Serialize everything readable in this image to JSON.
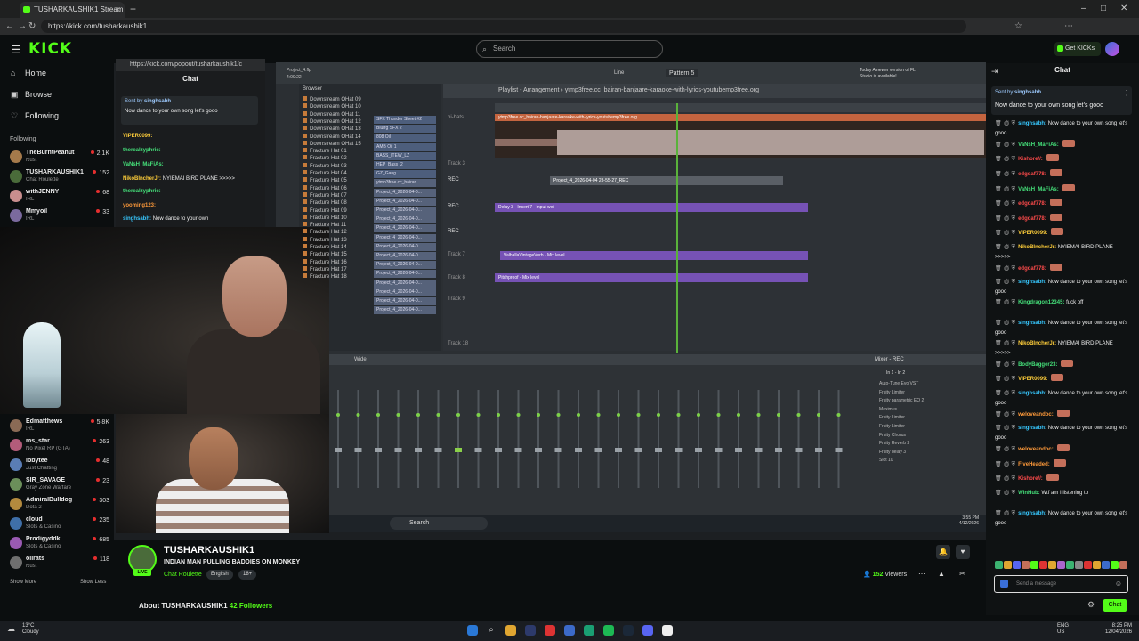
{
  "browser": {
    "tab_title": "TUSHARKAUSHIK1 Stream - W",
    "url": "https://kick.com/tusharkaushik1"
  },
  "header": {
    "search_placeholder": "Search",
    "get_kicks": "Get KICKs",
    "logo": "KICK"
  },
  "sidebar": {
    "nav": [
      {
        "label": "Home",
        "icon": "home-icon"
      },
      {
        "label": "Browse",
        "icon": "browse-icon"
      },
      {
        "label": "Following",
        "icon": "heart-icon"
      }
    ],
    "following_label": "Following",
    "channels_top": [
      {
        "name": "TheBurntPeanut",
        "category": "Rust",
        "viewers": "2.1K"
      },
      {
        "name": "TUSHARKAUSHIK1",
        "category": "Chat Roulette",
        "viewers": "152"
      },
      {
        "name": "withJENNY",
        "category": "IRL",
        "viewers": "68"
      },
      {
        "name": "Mmyoil",
        "category": "IRL",
        "viewers": "33"
      }
    ],
    "channels_bottom": [
      {
        "name": "Edmatthews",
        "category": "IRL",
        "viewers": "5.8K"
      },
      {
        "name": "ms_star",
        "category": "No Pixel RP (GTA)",
        "viewers": "263"
      },
      {
        "name": "ibbytee",
        "category": "Just Chatting",
        "viewers": "48"
      },
      {
        "name": "SIR_SAVAGE",
        "category": "Gray Zone Warfare",
        "viewers": "23"
      },
      {
        "name": "AdmiralBulldog",
        "category": "Dota 2",
        "viewers": "303"
      },
      {
        "name": "cloud",
        "category": "Slots & Casino",
        "viewers": "235"
      },
      {
        "name": "Prodigyddk",
        "category": "Slots & Casino",
        "viewers": "685"
      },
      {
        "name": "oilrats",
        "category": "Rust",
        "viewers": "118"
      }
    ],
    "show_more": "Show More",
    "show_less": "Show Less"
  },
  "popout": {
    "url": "https://kick.com/popout/tusharkaushik1/c",
    "title": "Chat",
    "banner_sender": "Sent by",
    "banner_user": "singhsabh",
    "banner_text": "Now dance to your own song let's gooo",
    "lines": [
      {
        "user": "VIPER0099:",
        "text": ""
      },
      {
        "user": "therealzyphric:",
        "text": ""
      },
      {
        "user": "VaNsH_MaFiAs:",
        "text": ""
      },
      {
        "user": "NikoBIncherJr:",
        "text": "NYIEMAI BIRD PLANE >>>>>"
      },
      {
        "user": "therealzyphric:",
        "text": ""
      },
      {
        "user": "yooming123:",
        "text": ""
      },
      {
        "user": "singhsabh:",
        "text": "Now dance to your own"
      }
    ]
  },
  "daw": {
    "project": "Project_4.flp",
    "time": "4:09:22",
    "pattern": "Pattern 5",
    "line_mode": "Line",
    "notice": "Today  A newer version of FL Studio is available!",
    "playlist_title": "Playlist - Arrangement",
    "playlist_file": "ytmp3free.cc_bairan-banjaare-karaoke-with-lyrics-youtubemp3free.org",
    "browser_label": "Browser",
    "browser_items": [
      "Downstream OHat 09",
      "Downstream OHat 10",
      "Downstream OHat 11",
      "Downstream OHat 12",
      "Downstream OHat 13",
      "Downstream OHat 14",
      "Downstream OHat 15",
      "Fracture Hat 01",
      "Fracture Hat 02",
      "Fracture Hat 03",
      "Fracture Hat 04",
      "Fracture Hat 05",
      "Fracture Hat 06",
      "Fracture Hat 07",
      "Fracture Hat 08",
      "Fracture Hat 09",
      "Fracture Hat 10",
      "Fracture Hat 11",
      "Fracture Hat 12",
      "Fracture Hat 13",
      "Fracture Hat 14",
      "Fracture Hat 15",
      "Fracture Hat 16",
      "Fracture Hat 17",
      "Fracture Hat 18"
    ],
    "channels": [
      "SFX Thunder Sheet #2",
      "Blurrg SFX 2",
      "808 Oil",
      "AMB Oil 1",
      "BASS_ITEW_LZ",
      "HEP_Bass_2",
      "GZ_Gang",
      "ytmp3free.cc_bairan...",
      "Project_4_2026-04-0...",
      "Project_4_2026-04-0...",
      "Project_4_2026-04-0...",
      "Project_4_2026-04-0...",
      "Project_4_2026-04-0...",
      "Project_4_2026-04-0...",
      "Project_4_2026-04-0...",
      "Project_4_2026-04-0...",
      "Project_4_2026-04-0...",
      "Project_4_2026-04-0...",
      "Project_4_2026-04-0...",
      "Project_4_2026-04-0...",
      "Project_4_2026-04-0...",
      "Project_4_2026-04-0..."
    ],
    "tracks": [
      "hi-hats",
      "Track 3",
      "REC",
      "REC",
      "REC",
      "Track 7",
      "Track 8",
      "Track 9",
      "Track 18"
    ],
    "wave_label": "ytmp3free.cc_bairan-banjaare-karaoke-with-lyrics-youtubemp3free.org",
    "clip_rec": "Project_4_2026-04-04 23-55-27_REC",
    "clip_rec2": "Project_4_2026-04-04 23-55-27_REC",
    "clip_delay": "Delay 3 - Insert 7 - Input wet",
    "clip_valhalla": "ValhallaVintageVerb - Mix level",
    "clip_pitch": "Pitchproof - Mix level",
    "mixer_title": "Mixer - REC",
    "mixer_mode": "Wide",
    "mixer_in": "In 1 - In 2",
    "fx_slots": [
      "Auto-Tune Evo VST",
      "Fruity Limiter",
      "Fruity parametric EQ 2",
      "Maximus",
      "Fruity Limiter",
      "Fruity Limiter",
      "Fruity Chorus",
      "Fruity Reverb 2",
      "Fruity delay 3",
      "Slot 10"
    ],
    "taskbar_search": "Search",
    "clock_time": "3:55 PM",
    "clock_date": "4/12/2026"
  },
  "stream": {
    "channel": "TUSHARKAUSHIK1",
    "title": "INDIAN MAN PULLING BADDIES ON MONKEY",
    "category": "Chat Roulette",
    "tags": [
      "English",
      "18+"
    ],
    "viewers": "152",
    "viewers_label": "Viewers",
    "live": "LIVE",
    "about": "About TUSHARKAUSHIK1",
    "followers": "42 Followers"
  },
  "chat": {
    "title": "Chat",
    "pinned_sender": "Sent by",
    "pinned_user": "singhsabh",
    "pinned_text": "Now dance to your own song let's gooo",
    "messages": [
      {
        "user": "singhsabh:",
        "text": "Now dance to your own song let's gooo",
        "color": "#37c8ff"
      },
      {
        "user": "VaNsH_MaFiAs:",
        "text": "",
        "color": "#45e07a"
      },
      {
        "user": "Kishore//:",
        "text": "",
        "color": "#ff4b4b"
      },
      {
        "user": "edgdaf778:",
        "text": "",
        "color": "#ff4b4b"
      },
      {
        "user": "VaNsH_MaFiAs:",
        "text": "",
        "color": "#45e07a"
      },
      {
        "user": "edgdaf778:",
        "text": "",
        "color": "#ff4b4b"
      },
      {
        "user": "edgdaf778:",
        "text": "",
        "color": "#ff4b4b"
      },
      {
        "user": "VIPER0099:",
        "text": "",
        "color": "#ffce3a"
      },
      {
        "user": "NikoBIncherJr:",
        "text": "NYIEMAI BIRD PLANE >>>>>",
        "color": "#ffce3a"
      },
      {
        "user": "edgdaf778:",
        "text": "",
        "color": "#ff4b4b"
      },
      {
        "user": "singhsabh:",
        "text": "Now dance to your own song let's gooo",
        "color": "#37c8ff"
      },
      {
        "user": "Kingdragon12345:",
        "text": "fuck off",
        "color": "#45e07a"
      },
      {
        "user": "singhsabh:",
        "text": "Now dance to your own song let's gooo",
        "color": "#37c8ff"
      },
      {
        "user": "NikoBIncherJr:",
        "text": "NYIEMAI BIRD PLANE >>>>>",
        "color": "#ffce3a"
      },
      {
        "user": "BodyBagger23:",
        "text": "",
        "color": "#45e07a"
      },
      {
        "user": "VIPER0099:",
        "text": "",
        "color": "#ffce3a"
      },
      {
        "user": "singhsabh:",
        "text": "Now dance to your own song let's gooo",
        "color": "#37c8ff"
      },
      {
        "user": "weloveandoc:",
        "text": "",
        "color": "#ff9a3a"
      },
      {
        "user": "singhsabh:",
        "text": "Now dance to your own song let's gooo",
        "color": "#37c8ff"
      },
      {
        "user": "weloveandoc:",
        "text": "",
        "color": "#ff9a3a"
      },
      {
        "user": "FiveHeaded:",
        "text": "",
        "color": "#ff9a3a"
      },
      {
        "user": "Kishore//:",
        "text": "",
        "color": "#ff4b4b"
      },
      {
        "user": "WinHub:",
        "text": "Wtf am I listening to",
        "color": "#45e07a"
      },
      {
        "user": "singhsabh:",
        "text": "Now dance to your own song let's gooo",
        "color": "#37c8ff"
      }
    ],
    "input_placeholder": "Send a message",
    "send_label": "Chat"
  },
  "taskbar": {
    "weather_temp": "13°C",
    "weather_desc": "Cloudy",
    "lang1": "ENG",
    "lang2": "US",
    "time": "8:25 PM",
    "date": "12/04/2026"
  },
  "colors": {
    "accent": "#53fc18",
    "background": "#0b0e0f"
  }
}
